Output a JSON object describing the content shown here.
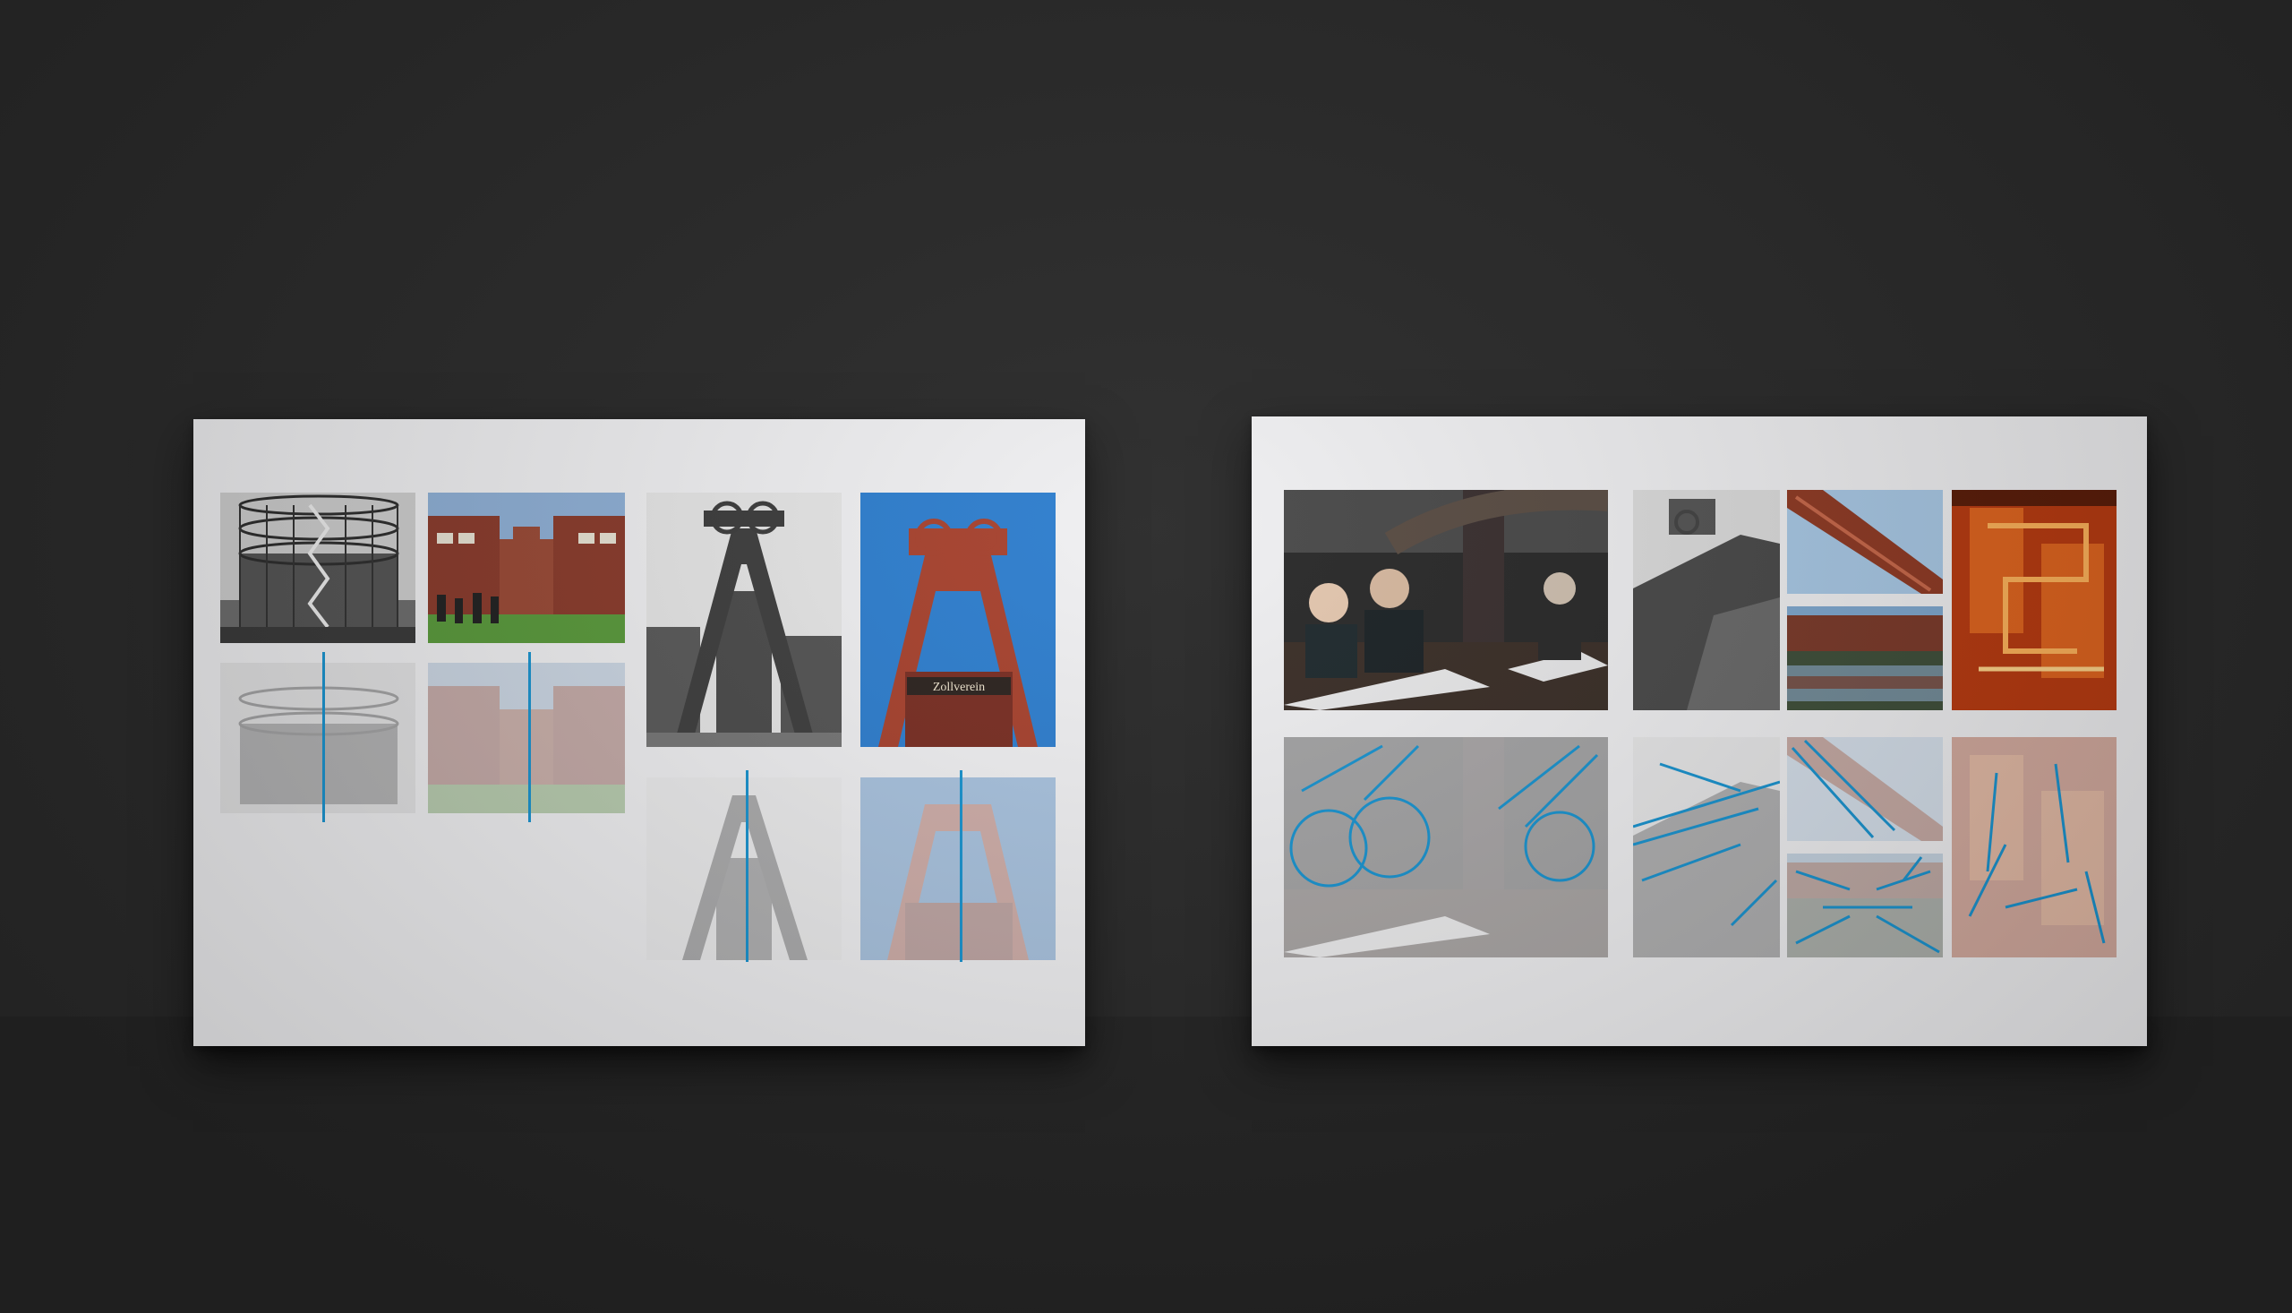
{
  "scene": {
    "background_color": "#2b2b2b",
    "board_color": "#f0f0f2",
    "accent_line_color": "#1a94d0"
  },
  "left_board": {
    "photos": [
      {
        "subject": "gasometer",
        "treatment": "black-and-white"
      },
      {
        "subject": "brick-building-courtyard",
        "treatment": "color"
      },
      {
        "subject": "headframe-tower",
        "treatment": "black-and-white"
      },
      {
        "subject": "headframe-tower-zollverein",
        "treatment": "color",
        "sign_text": "Zollverein"
      }
    ],
    "overlays": [
      {
        "subject": "gasometer",
        "treatment": "faded"
      },
      {
        "subject": "brick-building-courtyard",
        "treatment": "faded"
      },
      {
        "subject": "headframe-tower",
        "treatment": "faded"
      },
      {
        "subject": "headframe-tower-zollverein",
        "treatment": "faded"
      }
    ]
  },
  "right_board": {
    "photos": [
      {
        "subject": "people-at-table-industrial-hall",
        "treatment": "color"
      },
      {
        "subject": "headframe-corner-brick",
        "treatment": "black-and-white"
      },
      {
        "subject": "red-steel-beam-sky",
        "treatment": "color"
      },
      {
        "subject": "reflection-pool-industrial",
        "treatment": "color"
      },
      {
        "subject": "orange-lit-staircase",
        "treatment": "color"
      }
    ],
    "overlays": [
      {
        "subject": "people-at-table-industrial-hall",
        "treatment": "faded-with-blue-circles"
      },
      {
        "subject": "headframe-corner-brick",
        "treatment": "faded-with-blue-lines"
      },
      {
        "subject": "red-steel-beam-sky",
        "treatment": "faded-with-blue-lines"
      },
      {
        "subject": "reflection-pool-industrial",
        "treatment": "faded-with-blue-lines"
      },
      {
        "subject": "orange-lit-staircase",
        "treatment": "faded-with-blue-lines"
      }
    ]
  }
}
